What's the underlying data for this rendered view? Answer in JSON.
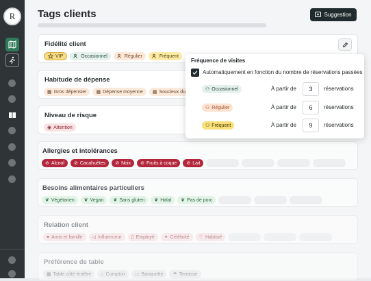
{
  "app": {
    "logo_letter": "R"
  },
  "header": {
    "title": "Tags clients",
    "suggestion_label": "Suggestion"
  },
  "colors": {
    "sidebar": "#2f3437",
    "accent_nav": "#2f7a5a",
    "dark_button": "#1f2b2e"
  },
  "sidebar": {
    "icons": [
      "map-icon",
      "walk-icon",
      "book-icon"
    ]
  },
  "cards": {
    "fidelite": {
      "title": "Fidélité client",
      "tags": [
        "VIP",
        "Occasionnel",
        "Régulier",
        "Fréquent"
      ]
    },
    "depense": {
      "title": "Habitude de dépense",
      "tags": [
        "Gros dépensier",
        "Dépense moyenne",
        "Soucieux du"
      ]
    },
    "risque": {
      "title": "Niveau de risque",
      "tags": [
        "Attention"
      ]
    },
    "allergies": {
      "title": "Allergies et intolérances",
      "tags": [
        "Alcool",
        "Cacahuètes",
        "Noix",
        "Fruits à coque",
        "Lait"
      ]
    },
    "besoins": {
      "title": "Besoins alimentaires particuliers",
      "tags": [
        "Végétarien",
        "Vegan",
        "Sans gluten",
        "Halal",
        "Pas de porc"
      ]
    },
    "relation": {
      "title": "Relation client",
      "tags": [
        "Amis et famille",
        "Influenceur",
        "Employé",
        "Célébrité",
        "Habitué"
      ]
    },
    "table": {
      "title": "Préférence de table",
      "tags": [
        "Table côté fenêtre",
        "Comptoir",
        "Banquette",
        "Terrasse"
      ]
    }
  },
  "popover": {
    "title": "Fréquence de visites",
    "auto_label": "Automatiquement en fonction du nombre de réservations passées",
    "from_label": "À partir de",
    "unit_label": "réservations",
    "rows": [
      {
        "tag": "Occasionnel",
        "value": "3"
      },
      {
        "tag": "Régulier",
        "value": "6"
      },
      {
        "tag": "Fréquent",
        "value": "9"
      }
    ]
  }
}
